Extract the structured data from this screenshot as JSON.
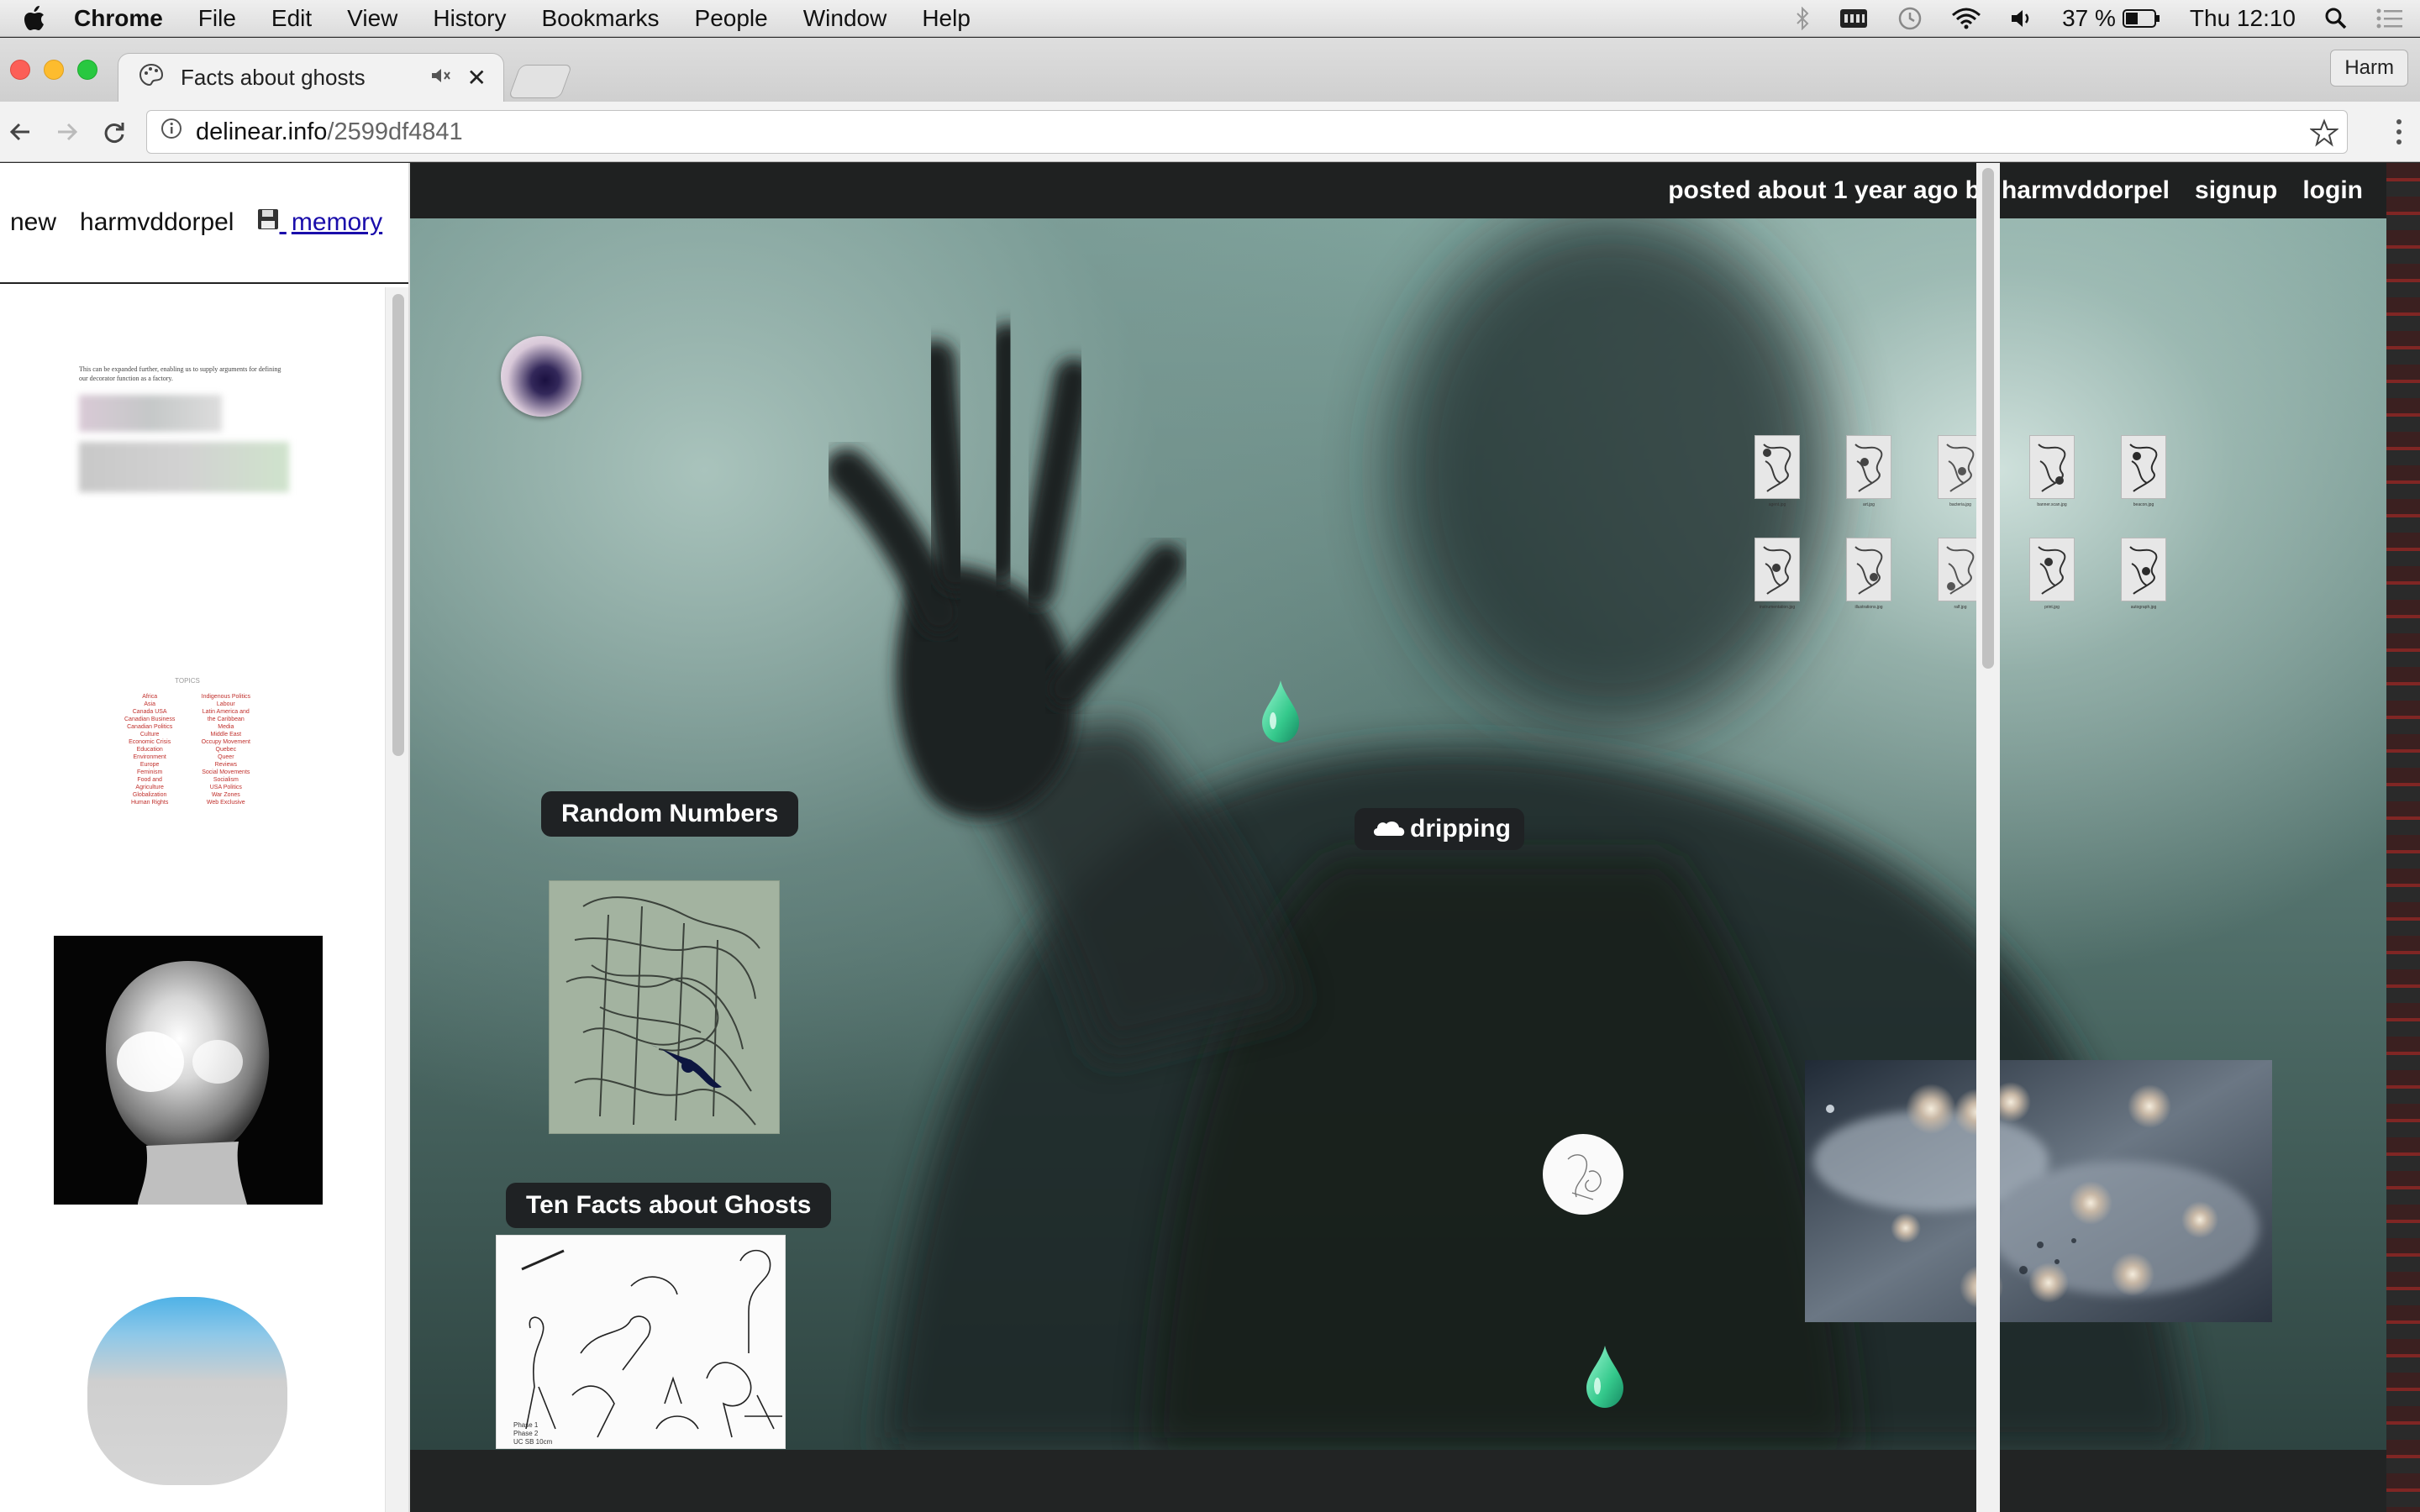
{
  "menubar": {
    "app": "Chrome",
    "items": [
      "File",
      "Edit",
      "View",
      "History",
      "Bookmarks",
      "People",
      "Window",
      "Help"
    ],
    "battery": "37 %",
    "clock": "Thu 12:10"
  },
  "browser": {
    "tab_title": "Facts about ghosts",
    "profile": "Harm",
    "url_host": "delinear.info",
    "url_path": "/2599df4841"
  },
  "leftnav": {
    "new": "new",
    "user": "harmvddorpel",
    "memory": "memory",
    "memory_icon": "floppy-disk-icon"
  },
  "thumbnails": {
    "doc_text": "This can be expanded further, enabling us to supply arguments for defining our decorator function as a factory.",
    "topics_header": "TOPICS",
    "topics_left": [
      "Africa",
      "Asia",
      "Canada USA",
      "Canadian Business",
      "Canadian Politics",
      "Culture",
      "Economic Crisis",
      "Education",
      "Environment",
      "Europe",
      "Feminism",
      "Food and",
      "Agriculture",
      "Globalization",
      "Human Rights"
    ],
    "topics_right": [
      "Indigenous Politics",
      "Labour",
      "Latin America and",
      "the Caribbean",
      "Media",
      "Middle East",
      "Occupy Movement",
      "Quebec",
      "Queer",
      "Reviews",
      "Social Movements",
      "Socialism",
      "USA Politics",
      "War Zones",
      "Web Exclusive"
    ]
  },
  "post": {
    "byline": "posted about 1 year ago by harmvddorpel",
    "signup": "signup",
    "login": "login"
  },
  "canvas": {
    "label_random": "Random Numbers",
    "label_dripping": "dripping",
    "label_ghosts": "Ten Facts about Ghosts",
    "gallery_captions": [
      "agent.jpg",
      "art.jpg",
      "bacteria.jpg",
      "banner.scan.jpg",
      "beacon.jpg",
      "instrumentation.jpg",
      "illustrations.jpg",
      "ralf.jpg",
      "print.jpg",
      "autograph.jpg"
    ],
    "sketch_caption": "Phase 1\nPhase 2\nUC SB 10cm"
  },
  "colors": {
    "drop_green": "#5fe0b0",
    "link_blue": "#1a0dab",
    "label_bg": "#1f2224"
  }
}
